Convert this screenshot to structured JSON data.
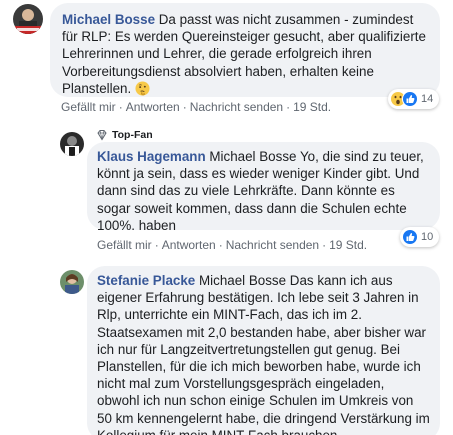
{
  "comments": [
    {
      "author": "Michael Bosse",
      "text": "Da passt was nicht zusammen - zumindest für RLP: Es werden Quereinsteiger gesucht, aber qualifizierte Lehrerinnen und Lehrer, die gerade erfolgreich ihren Vorbereitungsdienst absolviert haben, erhalten keine Planstellen.",
      "actions": {
        "like": "Gefällt mir",
        "reply": "Antworten",
        "message": "Nachricht senden",
        "time": "19 Std."
      },
      "reaction_count": "14"
    },
    {
      "badge": "Top-Fan",
      "author": "Klaus Hagemann",
      "text": "Michael Bosse Yo, die sind zu teuer, könnt ja sein, dass es wieder weniger Kinder gibt. Und dann sind das zu viele Lehrkräfte. Dann könnte es sogar soweit kommen, dass dann die Schulen echte 100%. haben",
      "actions": {
        "like": "Gefällt mir",
        "reply": "Antworten",
        "message": "Nachricht senden",
        "time": "19 Std."
      },
      "reaction_count": "10"
    },
    {
      "author": "Stefanie Placke",
      "text": "Michael Bosse Das kann ich aus eigener Erfahrung bestätigen. Ich lebe seit 3 Jahren in Rlp, unterrichte ein MINT-Fach, das ich im 2. Staatsexamen mit 2,0 bestanden habe, aber bisher war ich nur für Langzeitvertretungstellen gut genug. Bei Planstellen, für die ich mich beworben habe, wurde ich nicht mal zum Vorstellungsgespräch eingeladen, obwohl ich nun schon einige Schulen im Umkreis von 50 km kennengelernt habe, die dringend Verstärkung im Kollegium für mein MINT-Fach brauchen."
    }
  ],
  "colors": {
    "link": "#385898",
    "bubble": "#f0f2f5",
    "meta": "#606770",
    "like_blue": "#1877f2"
  },
  "icons": {
    "comment1_emoji": "thinking-face-icon",
    "comment1_reactions": [
      "wow-reaction-icon",
      "like-reaction-icon"
    ],
    "comment2_reactions": [
      "like-reaction-icon"
    ],
    "topfan": "diamond-icon"
  }
}
